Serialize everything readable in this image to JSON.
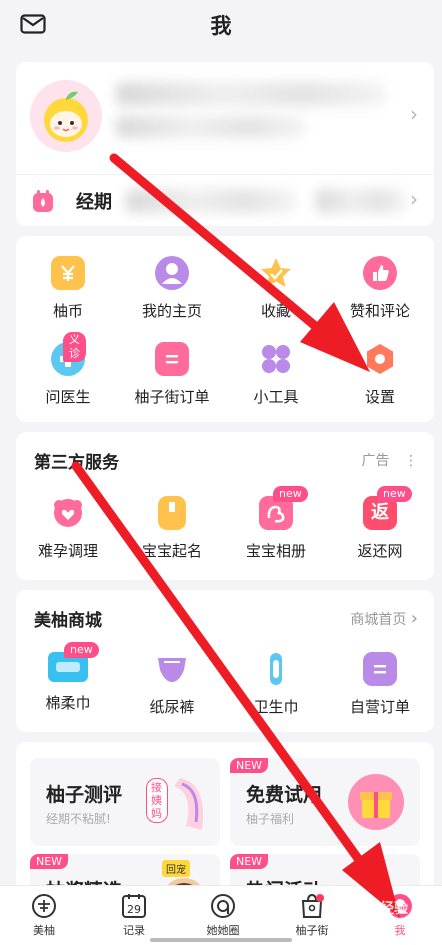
{
  "header": {
    "title": "我",
    "mail_icon": "mail-icon"
  },
  "profile": {
    "period_label": "经期",
    "calendar_icon": "period-calendar-icon"
  },
  "tools": {
    "items": [
      {
        "label": "柚币",
        "icon": "coin-icon",
        "color": "#ffc34d"
      },
      {
        "label": "我的主页",
        "icon": "person-icon",
        "color": "#b98ae8"
      },
      {
        "label": "收藏",
        "icon": "star-icon",
        "color": "#ffc34d"
      },
      {
        "label": "赞和评论",
        "icon": "thumbs-up-icon",
        "color": "#ff6b9b"
      },
      {
        "label": "问医生",
        "icon": "chat-doctor-icon",
        "color": "#5cc7f0",
        "badge": "义诊"
      },
      {
        "label": "柚子街订单",
        "icon": "order-icon",
        "color": "#ff6b9b"
      },
      {
        "label": "小工具",
        "icon": "tools-grid-icon",
        "color": "#b98ae8"
      },
      {
        "label": "设置",
        "icon": "settings-icon",
        "color": "#ff7a5c"
      }
    ]
  },
  "services": {
    "title": "第三方服务",
    "ad_label": "广告",
    "items": [
      {
        "label": "难孕调理",
        "icon": "heart-flower-icon",
        "color": "#ff6b9b"
      },
      {
        "label": "宝宝起名",
        "icon": "name-card-icon",
        "color": "#ffc34d"
      },
      {
        "label": "宝宝相册",
        "icon": "baby-album-icon",
        "color": "#ff6b9b",
        "badge": "new"
      },
      {
        "label": "返还网",
        "icon": "rebate-icon",
        "color": "#ff4d6d",
        "badge": "new",
        "glyph": "返"
      }
    ]
  },
  "shop": {
    "title": "美柚商城",
    "link": "商城首页",
    "items": [
      {
        "label": "棉柔巾",
        "icon": "cotton-towel-icon",
        "color": "#37c0f0",
        "badge": "new"
      },
      {
        "label": "纸尿裤",
        "icon": "diaper-icon",
        "color": "#b98ae8"
      },
      {
        "label": "卫生巾",
        "icon": "pad-icon",
        "color": "#5cc7f0"
      },
      {
        "label": "自营订单",
        "icon": "self-order-icon",
        "color": "#b98ae8"
      }
    ]
  },
  "promo": {
    "tiles": [
      {
        "title": "柚子测评",
        "subtitle": "经期不粘腻!",
        "sticker": "接姨妈"
      },
      {
        "title": "免费试用",
        "subtitle": "柚子福利",
        "tag": "NEW"
      },
      {
        "title": "柚酱精选",
        "tag": "NEW",
        "sticker": "回宠"
      },
      {
        "title": "热门活动",
        "tag": "NEW"
      }
    ]
  },
  "bottom_nav": {
    "items": [
      {
        "label": "美柚",
        "icon": "meiyou-icon"
      },
      {
        "label": "记录",
        "icon": "calendar-record-icon",
        "date": "29"
      },
      {
        "label": "她她圈",
        "icon": "circle-icon"
      },
      {
        "label": "柚子街",
        "icon": "shopping-bag-icon"
      },
      {
        "label": "我",
        "icon": "me-icon",
        "active": true
      }
    ]
  },
  "watermark": "Baidu 经验",
  "colors": {
    "accent": "#ff4f8b",
    "arrow": "#ee1c24",
    "background": "#f4f4f6"
  }
}
